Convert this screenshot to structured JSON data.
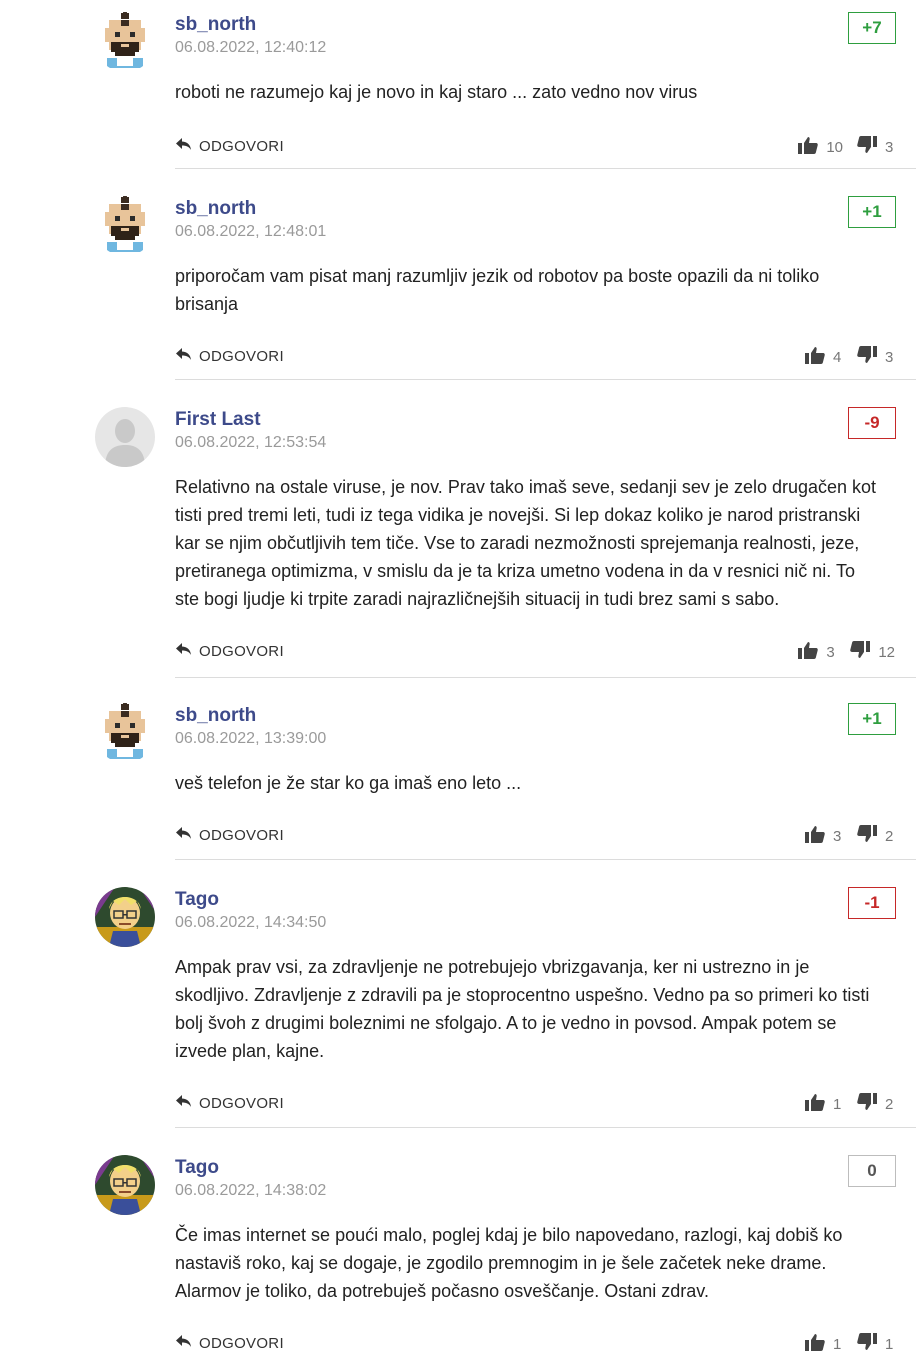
{
  "reply_label": "ODGOVORI",
  "colors": {
    "author": "#3d4a8a",
    "positive": "#2e9e3f",
    "negative": "#c62828",
    "meta": "#9a9a9a"
  },
  "icons": {
    "reply": "reply-arrow-icon",
    "like": "thumbs-up-icon",
    "dislike": "thumbs-down-icon"
  },
  "comments": [
    {
      "author": "sb_north",
      "date": "06.08.2022, 12:40:12",
      "score": "+7",
      "score_type": "pos",
      "avatar": "pixel-character",
      "lines": [
        "roboti ne razumejo kaj je novo in kaj staro ... zato vedno nov virus"
      ],
      "likes": "10",
      "dislikes": "3"
    },
    {
      "author": "sb_north",
      "date": "06.08.2022, 12:48:01",
      "score": "+1",
      "score_type": "pos",
      "avatar": "pixel-character",
      "lines": [
        "priporočam vam pisat manj razumljiv jezik od robotov pa boste opazili da ni toliko",
        "brisanja"
      ],
      "likes": "4",
      "dislikes": "3"
    },
    {
      "author": "First Last",
      "date": "06.08.2022, 12:53:54",
      "score": "-9",
      "score_type": "neg",
      "avatar": "default-silhouette",
      "lines": [
        "Relativno na ostale viruse, je nov. Prav tako imaš seve, sedanji sev je zelo drugačen kot",
        "tisti pred tremi leti, tudi iz tega vidika je novejši. Si lep dokaz koliko je narod pristranski",
        "kar se njim občutljivih tem tiče. Vse to zaradi nezmožnosti sprejemanja realnosti, jeze,",
        "pretiranega optimizma, v smislu da je ta kriza umetno vodena in da v resnici nič ni. To",
        "ste bogi ljudje ki trpite zaradi najrazličnejših situacij in tudi brez sami s sabo."
      ],
      "likes": "3",
      "dislikes": "12"
    },
    {
      "author": "sb_north",
      "date": "06.08.2022, 13:39:00",
      "score": "+1",
      "score_type": "pos",
      "avatar": "pixel-character",
      "lines": [
        "veš telefon je že star ko ga imaš eno leto ..."
      ],
      "likes": "3",
      "dislikes": "2"
    },
    {
      "author": "Tago",
      "date": "06.08.2022, 14:34:50",
      "score": "-1",
      "score_type": "neg",
      "avatar": "cartoon-character",
      "lines": [
        "Ampak prav vsi, za zdravljenje ne potrebujejo vbrizgavanja, ker ni ustrezno in je",
        "skodljivo. Zdravljenje z zdravili pa je stoprocentno uspešno. Vedno pa so primeri ko tisti",
        "bolj švoh z drugimi boleznimi ne sfolgajo. A to je vedno in povsod. Ampak potem se",
        "izvede plan, kajne."
      ],
      "likes": "1",
      "dislikes": "2"
    },
    {
      "author": "Tago",
      "date": "06.08.2022, 14:38:02",
      "score": "0",
      "score_type": "zero",
      "avatar": "cartoon-character",
      "lines": [
        "Če imas internet se poući malo, poglej kdaj je bilo napovedano, razlogi, kaj dobiš ko",
        "nastaviš roko, kaj se dogaje, je zgodilo premnogim in je šele začetek neke drame.",
        "Alarmov je toliko, da potrebuješ počasno osveščanje. Ostani zdrav."
      ],
      "likes": "1",
      "dislikes": "1"
    }
  ]
}
